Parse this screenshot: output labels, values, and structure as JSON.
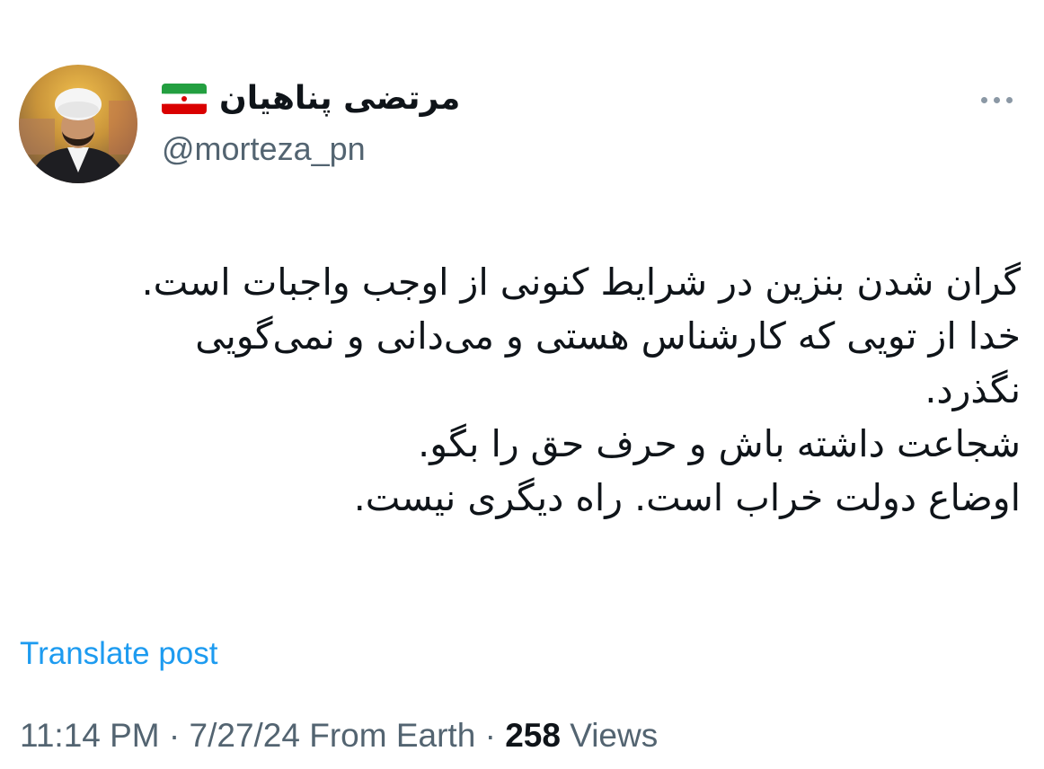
{
  "author": {
    "display_name": "مرتضی پناهیان",
    "handle": "@morteza_pn",
    "flag_icon": "iran-flag-icon"
  },
  "post": {
    "lines": [
      "گران شدن بنزین در شرایط کنونی از اوجب واجبات است.",
      "خدا از تویی که کارشناس هستی و می‌دانی و نمی‌گویی",
      "نگذرد.",
      "شجاعت داشته باش و حرف حق را بگو.",
      "اوضاع دولت خراب است. راه دیگری نیست."
    ],
    "translate_label": "Translate post"
  },
  "meta": {
    "time": "11:14 PM",
    "separator": " · ",
    "date": "7/27/24",
    "location": "From Earth",
    "views_count": "258",
    "views_label": "Views"
  },
  "colors": {
    "text_primary": "#0f1419",
    "text_secondary": "#536471",
    "link": "#1d9bf0"
  }
}
